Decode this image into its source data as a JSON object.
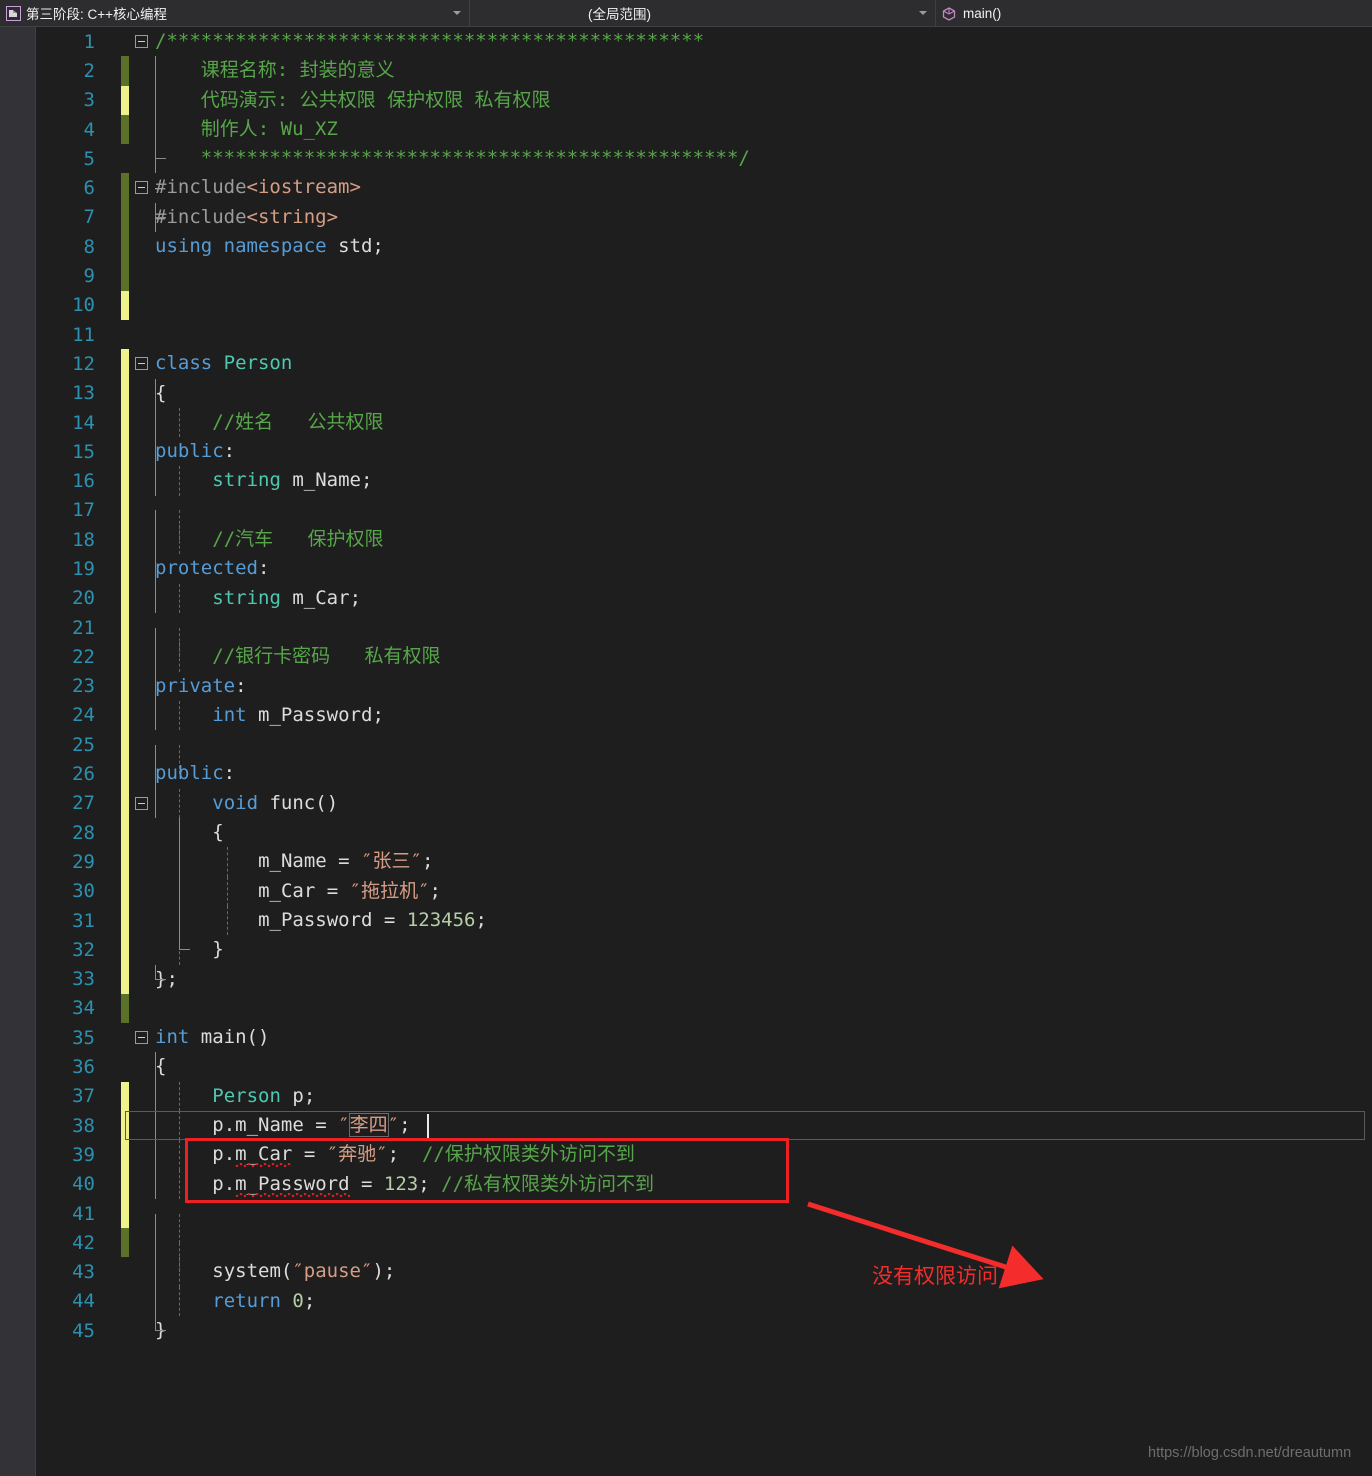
{
  "topbar": {
    "scope_selector": {
      "icon": "file-cpp-icon",
      "label": "第三阶段: C++核心编程",
      "dropdown_icon": "chevron-down-icon"
    },
    "global_selector": {
      "label": "(全局范围)",
      "dropdown_icon": "chevron-down-icon"
    },
    "member_selector": {
      "icon": "method-cube-icon",
      "label": "main()"
    }
  },
  "editor": {
    "theme": {
      "background": "#1e1e1e",
      "gutter_background": "#333337",
      "line_number_color": "#2b91af",
      "comment_color": "#57a64a",
      "keyword_color": "#569cd6",
      "type_color": "#4ec9b0",
      "string_color": "#d69d85",
      "number_color": "#b5cea8",
      "change_bar_saved": "#5b7028",
      "change_bar_unsaved": "#eef28b",
      "error_squiggle": "#e01b24"
    },
    "current_line": 38,
    "total_lines": 45,
    "lines": [
      {
        "n": 1,
        "change": "none",
        "fold": "collapse",
        "text": "/***********************************************"
      },
      {
        "n": 2,
        "change": "green",
        "fold": "",
        "text": "    课程名称: 封装的意义"
      },
      {
        "n": 3,
        "change": "yellow",
        "fold": "",
        "text": "    代码演示: 公共权限 保护权限 私有权限"
      },
      {
        "n": 4,
        "change": "green",
        "fold": "",
        "text": "    制作人: Wu_XZ"
      },
      {
        "n": 5,
        "change": "none",
        "fold": "",
        "text": "    ***********************************************/"
      },
      {
        "n": 6,
        "change": "green",
        "fold": "collapse",
        "text": "#include<iostream>"
      },
      {
        "n": 7,
        "change": "green",
        "fold": "",
        "text": "#include<string>"
      },
      {
        "n": 8,
        "change": "green",
        "fold": "",
        "text": "using namespace std;"
      },
      {
        "n": 9,
        "change": "green",
        "fold": "",
        "text": ""
      },
      {
        "n": 10,
        "change": "yellow",
        "fold": "",
        "text": ""
      },
      {
        "n": 11,
        "change": "none",
        "fold": "",
        "text": ""
      },
      {
        "n": 12,
        "change": "yellow",
        "fold": "collapse",
        "text": "class Person"
      },
      {
        "n": 13,
        "change": "yellow",
        "fold": "",
        "text": "{"
      },
      {
        "n": 14,
        "change": "yellow",
        "fold": "",
        "text": "     //姓名   公共权限"
      },
      {
        "n": 15,
        "change": "yellow",
        "fold": "",
        "text": "public:"
      },
      {
        "n": 16,
        "change": "yellow",
        "fold": "",
        "text": "     string m_Name;"
      },
      {
        "n": 17,
        "change": "yellow",
        "fold": "",
        "text": ""
      },
      {
        "n": 18,
        "change": "yellow",
        "fold": "",
        "text": "     //汽车   保护权限"
      },
      {
        "n": 19,
        "change": "yellow",
        "fold": "",
        "text": "protected:"
      },
      {
        "n": 20,
        "change": "yellow",
        "fold": "",
        "text": "     string m_Car;"
      },
      {
        "n": 21,
        "change": "yellow",
        "fold": "",
        "text": ""
      },
      {
        "n": 22,
        "change": "yellow",
        "fold": "",
        "text": "     //银行卡密码   私有权限"
      },
      {
        "n": 23,
        "change": "yellow",
        "fold": "",
        "text": "private:"
      },
      {
        "n": 24,
        "change": "yellow",
        "fold": "",
        "text": "     int m_Password;"
      },
      {
        "n": 25,
        "change": "yellow",
        "fold": "",
        "text": ""
      },
      {
        "n": 26,
        "change": "yellow",
        "fold": "",
        "text": "public:"
      },
      {
        "n": 27,
        "change": "yellow",
        "fold": "collapse",
        "text": "     void func()"
      },
      {
        "n": 28,
        "change": "yellow",
        "fold": "",
        "text": "     {"
      },
      {
        "n": 29,
        "change": "yellow",
        "fold": "",
        "text": "         m_Name = \"张三\";"
      },
      {
        "n": 30,
        "change": "yellow",
        "fold": "",
        "text": "         m_Car = \"拖拉机\";"
      },
      {
        "n": 31,
        "change": "yellow",
        "fold": "",
        "text": "         m_Password = 123456;"
      },
      {
        "n": 32,
        "change": "yellow",
        "fold": "",
        "text": "     }"
      },
      {
        "n": 33,
        "change": "yellow",
        "fold": "",
        "text": "};"
      },
      {
        "n": 34,
        "change": "green",
        "fold": "",
        "text": ""
      },
      {
        "n": 35,
        "change": "none",
        "fold": "collapse",
        "text": "int main()"
      },
      {
        "n": 36,
        "change": "none",
        "fold": "",
        "text": "{"
      },
      {
        "n": 37,
        "change": "yellow",
        "fold": "",
        "text": "     Person p;"
      },
      {
        "n": 38,
        "change": "yellow",
        "fold": "",
        "text": "     p.m_Name = \"李四\";"
      },
      {
        "n": 39,
        "change": "yellow",
        "fold": "",
        "text": "     p.m_Car = \"奔驰\";  //保护权限类外访问不到"
      },
      {
        "n": 40,
        "change": "yellow",
        "fold": "",
        "text": "     p.m_Password = 123; //私有权限类外访问不到"
      },
      {
        "n": 41,
        "change": "yellow",
        "fold": "",
        "text": ""
      },
      {
        "n": 42,
        "change": "green",
        "fold": "",
        "text": ""
      },
      {
        "n": 43,
        "change": "none",
        "fold": "",
        "text": "     system(\"pause\");"
      },
      {
        "n": 44,
        "change": "none",
        "fold": "",
        "text": "     return 0;"
      },
      {
        "n": 45,
        "change": "none",
        "fold": "",
        "text": "}"
      }
    ]
  },
  "annotations": {
    "red_box": {
      "covers_lines": "39-40",
      "color": "#ed2024"
    },
    "arrow": {
      "color": "#f42c2c",
      "direction": "down-right"
    },
    "callout_text": "没有权限访问"
  },
  "watermark": {
    "text": "https://blog.csdn.net/dreautumn"
  }
}
